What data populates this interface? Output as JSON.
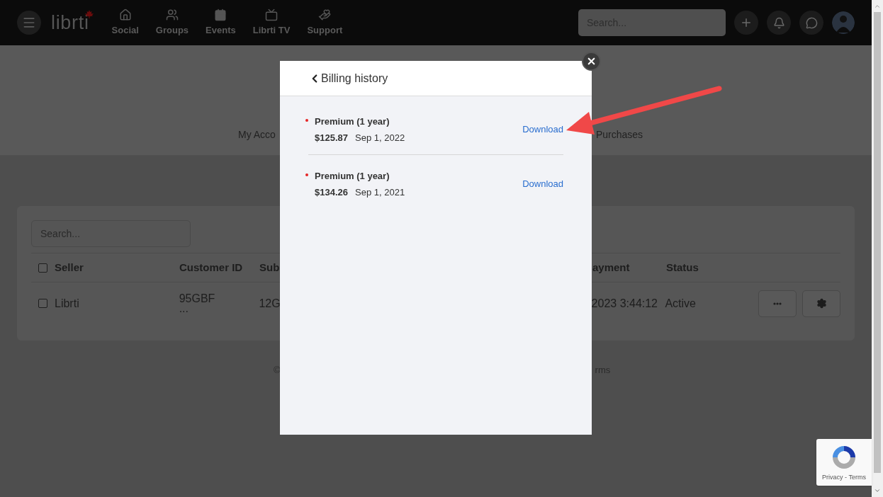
{
  "top_bar": {
    "logo": "librti",
    "nav": [
      {
        "label": "Social"
      },
      {
        "label": "Groups"
      },
      {
        "label": "Events"
      },
      {
        "label": "Librti TV"
      },
      {
        "label": "Support"
      }
    ],
    "search": {
      "placeholder": "Search..."
    }
  },
  "page": {
    "tabs": [
      "My Acco",
      "Purchases"
    ],
    "search": {
      "placeholder": "Search..."
    },
    "table": {
      "columns": [
        {
          "label": "Seller",
          "checked": false
        },
        {
          "label": "Customer ID"
        },
        {
          "label": "Sub"
        },
        {
          "label": "ayment"
        },
        {
          "label": "Status"
        }
      ],
      "rows": [
        {
          "checked": false,
          "cells": [
            "Librti",
            "95GBF\n...",
            "12G",
            "2023 3:44:12",
            "Active"
          ]
        }
      ]
    },
    "footer": [
      "©",
      "rms"
    ]
  },
  "modal": {
    "title": "Billing history",
    "items": [
      {
        "plan": "Premium (1 year)",
        "amount": "$125.87",
        "date": "Sep 1, 2022",
        "action": "Download",
        "color": "#e52525"
      },
      {
        "plan": "Premium (1 year)",
        "amount": "$134.26",
        "date": "Sep 1, 2021",
        "action": "Download",
        "color": "#e52525"
      }
    ]
  },
  "recaptcha": {
    "links": "Privacy - Terms"
  }
}
